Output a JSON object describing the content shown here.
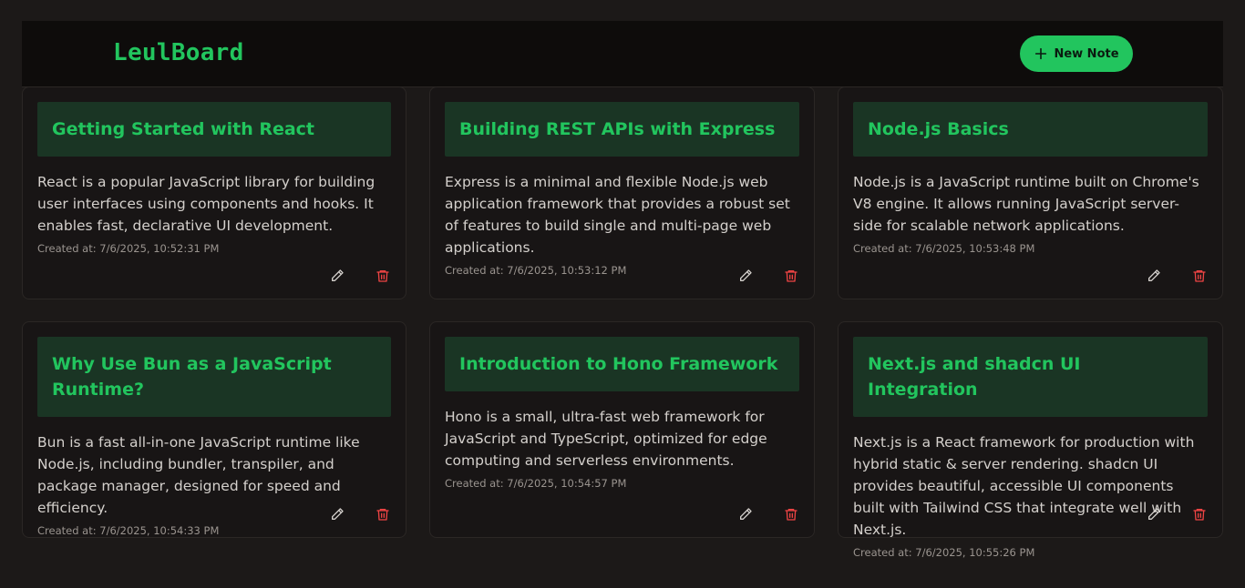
{
  "navbar": {
    "brand": "LeulBoard",
    "new_note_label": "New Note"
  },
  "colors": {
    "background": "#1c1918",
    "accent": "#22c55e",
    "delete": "#ef4444"
  },
  "notes": [
    {
      "title": "Getting Started with React",
      "content": "React is a popular JavaScript library for building user interfaces using components and hooks. It enables fast, declarative UI development.",
      "created": "Created at: 7/6/2025, 10:52:31 PM"
    },
    {
      "title": "Building REST APIs with Express",
      "content": "Express is a minimal and flexible Node.js web application framework that provides a robust set of features to build single and multi-page web applications.",
      "created": "Created at: 7/6/2025, 10:53:12 PM"
    },
    {
      "title": "Node.js Basics",
      "content": "Node.js is a JavaScript runtime built on Chrome's V8 engine. It allows running JavaScript server-side for scalable network applications.",
      "created": "Created at: 7/6/2025, 10:53:48 PM"
    },
    {
      "title": "Why Use Bun as a JavaScript Runtime?",
      "content": "Bun is a fast all-in-one JavaScript runtime like Node.js, including bundler, transpiler, and package manager, designed for speed and efficiency.",
      "created": "Created at: 7/6/2025, 10:54:33 PM"
    },
    {
      "title": "Introduction to Hono Framework",
      "content": "Hono is a small, ultra-fast web framework for JavaScript and TypeScript, optimized for edge computing and serverless environments.",
      "created": "Created at: 7/6/2025, 10:54:57 PM"
    },
    {
      "title": "Next.js and shadcn UI Integration",
      "content": "Next.js is a React framework for production with hybrid static & server rendering. shadcn UI provides beautiful, accessible UI components built with Tailwind CSS that integrate well with Next.js.",
      "created": "Created at: 7/6/2025, 10:55:26 PM"
    }
  ]
}
